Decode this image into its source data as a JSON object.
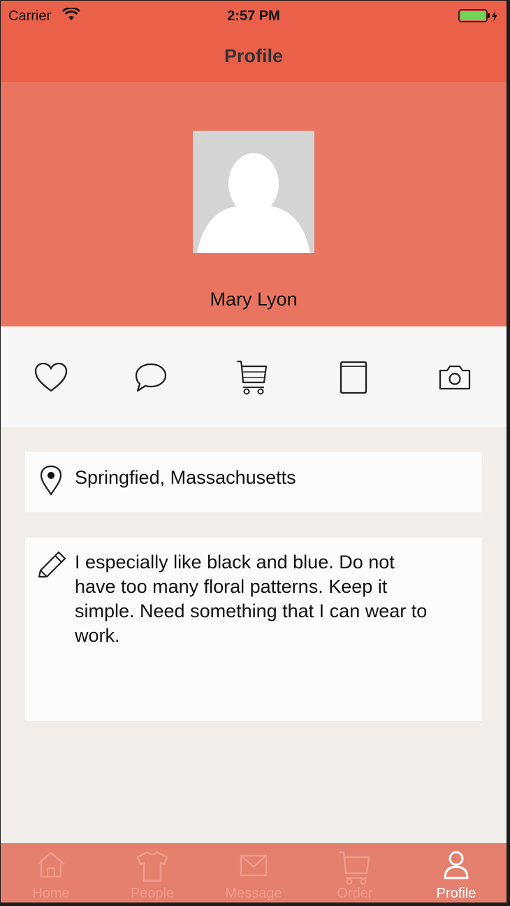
{
  "status_bar": {
    "carrier": "Carrier",
    "time": "2:57 PM"
  },
  "nav": {
    "title": "Profile"
  },
  "profile": {
    "name": "Mary Lyon"
  },
  "actions": [
    "heart-icon",
    "comment-icon",
    "cart-icon",
    "book-icon",
    "camera-icon"
  ],
  "location": {
    "text": "Springfied, Massachusetts"
  },
  "notes": {
    "text": "I especially like black and blue. Do not have too many floral patterns. Keep it simple. Need something that I can wear to work."
  },
  "tabs": [
    {
      "label": "Home",
      "icon": "home-icon"
    },
    {
      "label": "People",
      "icon": "shirt-icon"
    },
    {
      "label": "Message",
      "icon": "envelope-icon"
    },
    {
      "label": "Order",
      "icon": "cart-icon"
    },
    {
      "label": "Profile",
      "icon": "person-icon",
      "active": true
    }
  ],
  "colors": {
    "bar": "#ea6048",
    "header": "#e97560",
    "tab_bar": "#e5806e",
    "tab_inactive": "#ef9b8c",
    "tab_active": "#ffffff"
  }
}
